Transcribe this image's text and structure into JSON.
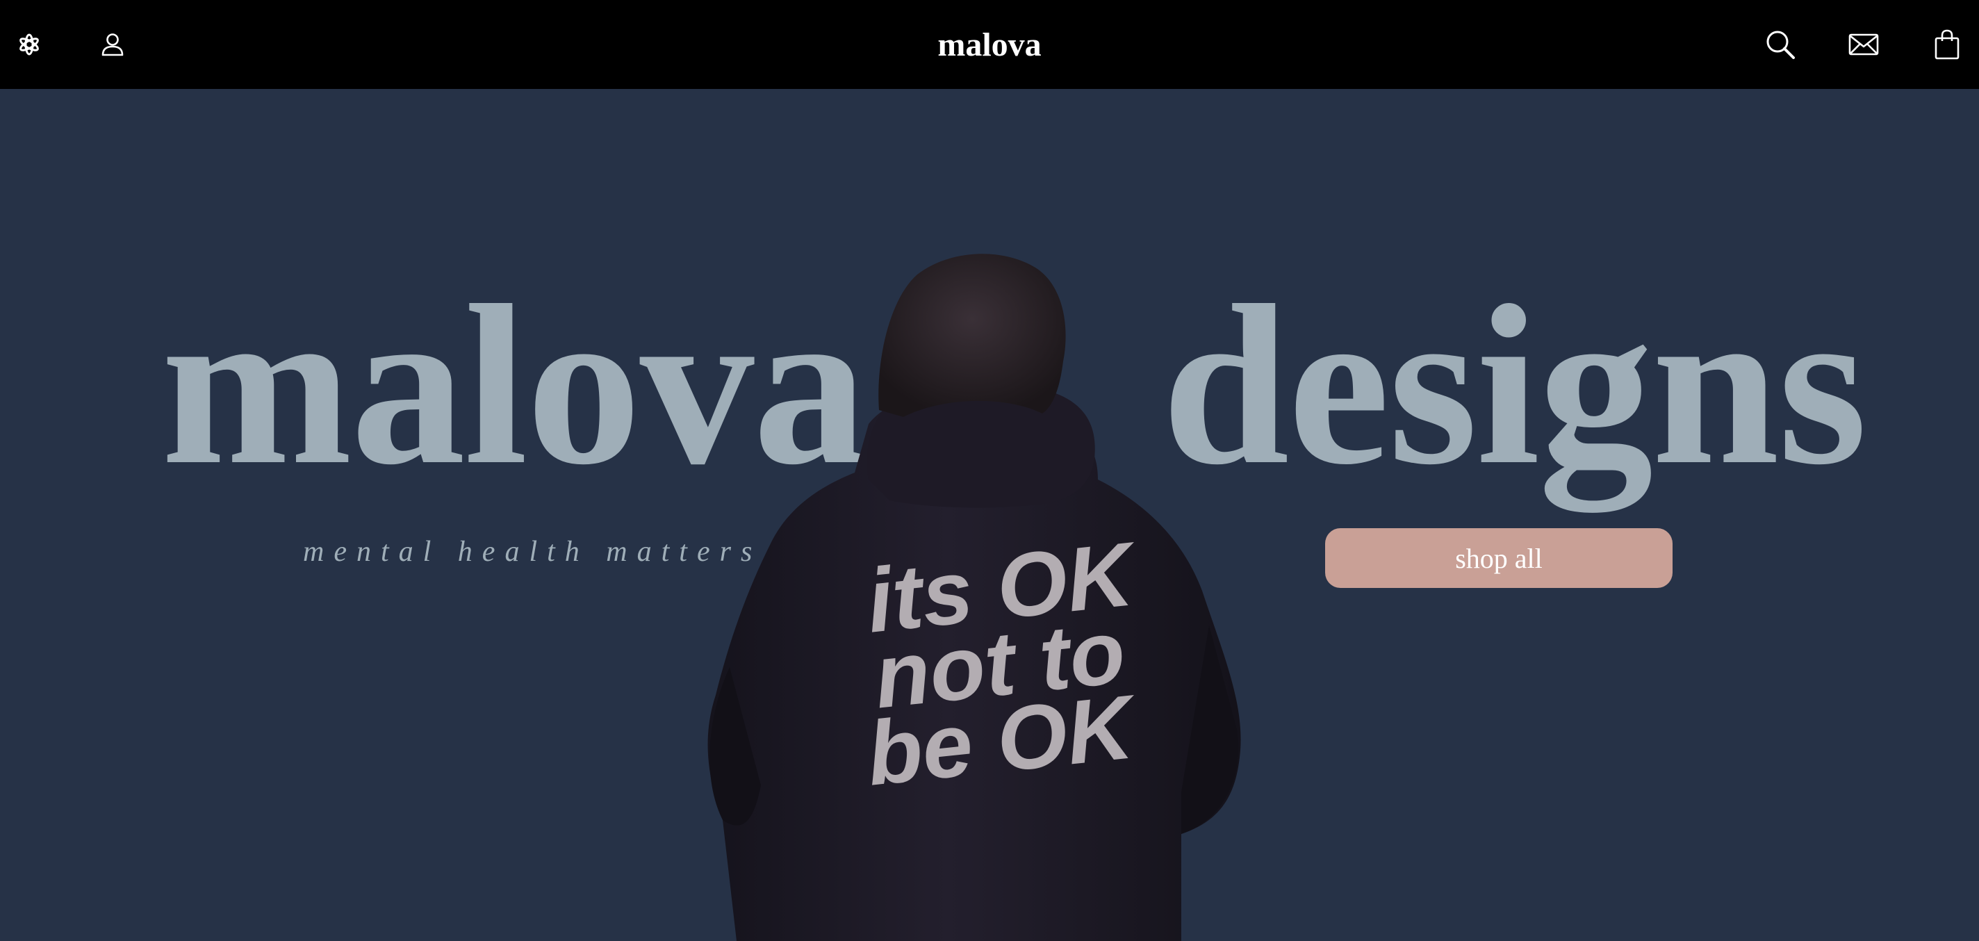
{
  "header": {
    "brand": "malova",
    "left_icons": [
      "snowflake-icon",
      "user-icon"
    ],
    "right_icons": [
      "search-icon",
      "mail-icon",
      "bag-icon"
    ]
  },
  "hero": {
    "word_left": "malova",
    "word_right": "designs",
    "tagline": "mental health matters",
    "cta_label": "shop all",
    "hoodie_print": [
      "its OK",
      "not to",
      "be OK"
    ]
  },
  "colors": {
    "header_bg": "#000000",
    "hero_bg": "#263247",
    "hero_text": "#9faeb8",
    "cta_bg": "#c9a096",
    "hoodie": "#1d1a26",
    "hoodie_print": "#b3adb2"
  }
}
